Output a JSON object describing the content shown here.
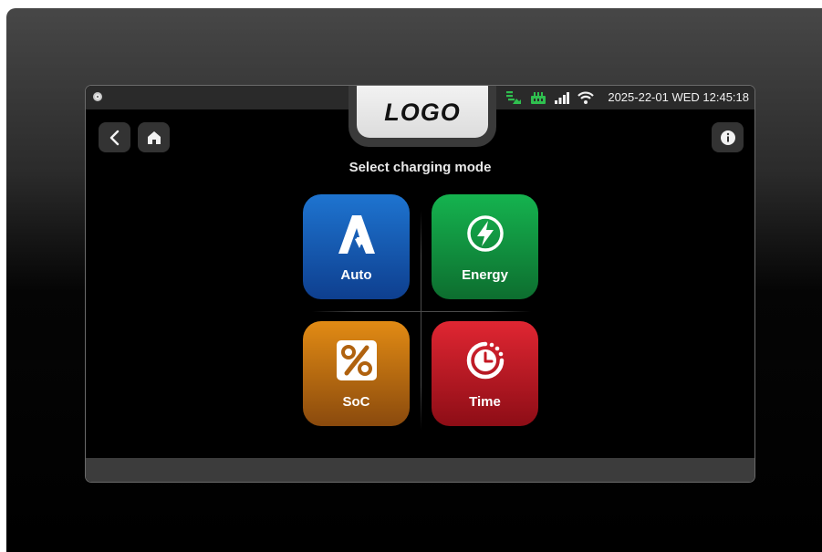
{
  "header": {
    "logo_text": "LOGO",
    "datetime": "2025-22-01 WED 12:45:18",
    "status_icons": [
      "solar-icon",
      "grid-icon",
      "signal-icon",
      "wifi-icon"
    ],
    "status_color": "#2fbf4f"
  },
  "nav": {
    "back_icon": "chevron-left-icon",
    "home_icon": "home-icon",
    "info_icon": "info-icon"
  },
  "main": {
    "prompt": "Select charging mode",
    "modes": [
      {
        "label": "Auto",
        "icon": "auto-a-icon",
        "color": "#1565c0"
      },
      {
        "label": "Energy",
        "icon": "lightning-icon",
        "color": "#13a047"
      },
      {
        "label": "SoC",
        "icon": "percent-icon",
        "color": "#c9790f"
      },
      {
        "label": "Time",
        "icon": "timer-clock-icon",
        "color": "#c81a26"
      }
    ]
  }
}
